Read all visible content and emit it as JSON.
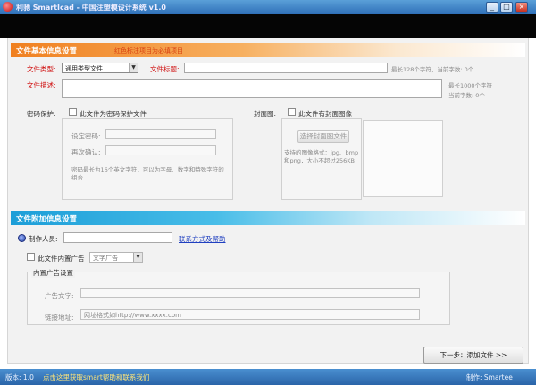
{
  "window": {
    "title": "利驰 SmartIcad - 中国注塑模设计系统 v1.0",
    "minimize_label": "_",
    "maximize_label": "□",
    "close_label": "×"
  },
  "section_basic": {
    "title": "文件基本信息设置",
    "hint": "红色标注项目为必填项目"
  },
  "basic": {
    "file_type_label": "文件类型:",
    "file_type_value": "通用类型文件",
    "file_title_label": "文件标题:",
    "file_title_value": "",
    "title_hint": "最长128个字符，当前字数: 0个",
    "file_desc_label": "文件描述:",
    "file_desc_value": "",
    "desc_hint_1": "最长1000个字符",
    "desc_hint_2": "当前字数: 0个"
  },
  "protect": {
    "label": "密码保护:",
    "checkbox_label": "此文件为密码保护文件",
    "password_label": "设定密码:",
    "confirm_label": "再次确认:",
    "note": "密码最长为16个英文字符，可以为字母、数字和特殊字符的组合"
  },
  "cover": {
    "label": "封面图:",
    "checkbox_label": "此文件有封面图像",
    "select_button": "选择封面图文件",
    "note": "支持的图像格式：jpg、bmp和png，大小不超过256KB"
  },
  "section_extra": {
    "title": "文件附加信息设置"
  },
  "extra": {
    "author_label": "制作人员:",
    "author_value": "",
    "author_link": "联系方式及帮助",
    "ad_checkbox_label": "此文件内置广告",
    "ad_select_value": "文字广告",
    "ad_group_legend": "内置广告设置",
    "ad_text_label": "广告文字:",
    "ad_text_value": "",
    "ad_link_label": "链接地址:",
    "ad_link_value": "网址格式如http://www.xxxx.com"
  },
  "footer": {
    "next_button": "下一步：添加文件 >>"
  },
  "status": {
    "version": "版本: 1.0",
    "help_link": "点击这里获取smart帮助和联系我们",
    "owner": "制作: Smartee"
  }
}
